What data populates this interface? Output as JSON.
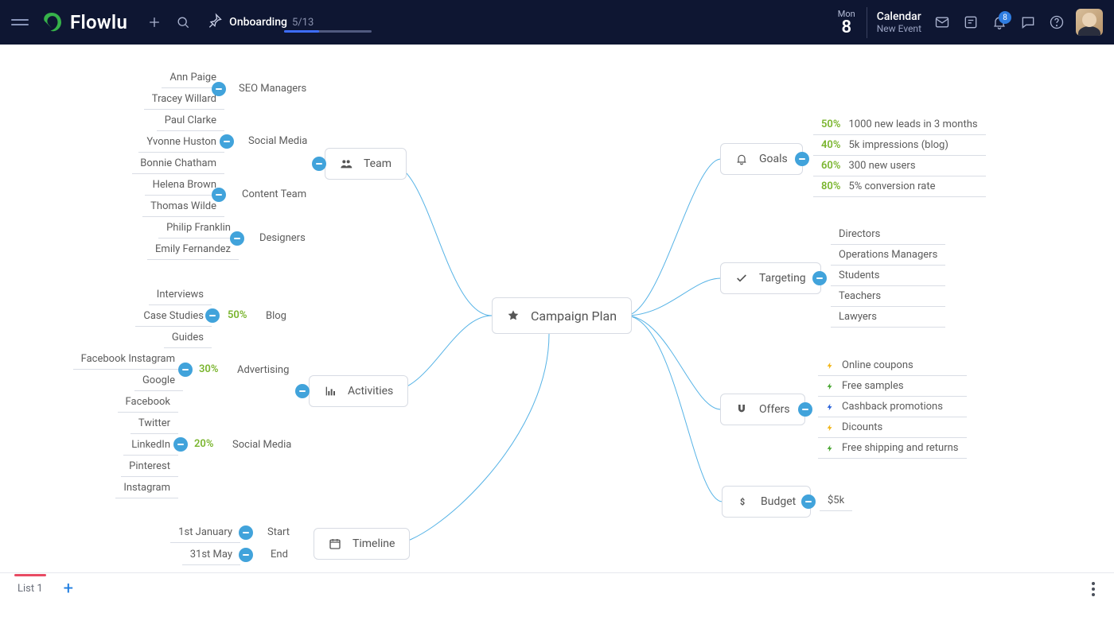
{
  "header": {
    "logo": "Flowlu",
    "onboarding": {
      "label": "Onboarding",
      "count": "5/13"
    },
    "calendar": {
      "dow": "Mon",
      "day": "8",
      "label": "Calendar",
      "new": "New Event"
    },
    "notif_count": "8"
  },
  "center": {
    "title": "Campaign Plan"
  },
  "team": {
    "title": "Team",
    "groups": [
      {
        "label": "SEO Managers",
        "members": [
          "Ann Paige",
          "Tracey  Willard"
        ]
      },
      {
        "label": "Social Media",
        "members": [
          "Paul Clarke",
          "Yvonne Huston",
          "Bonnie Chatham"
        ]
      },
      {
        "label": "Content Team",
        "members": [
          "Helena Brown",
          "Thomas Wilde"
        ]
      },
      {
        "label": "Designers",
        "members": [
          "Philip Franklin",
          "Emily Fernandez"
        ]
      }
    ]
  },
  "activities": {
    "title": "Activities",
    "groups": [
      {
        "pct": "50%",
        "label": "Blog",
        "members": [
          "Interviews",
          "Case Studies",
          "Guides"
        ]
      },
      {
        "pct": "30%",
        "label": "Advertising",
        "members": [
          "Facebook   Instagram",
          "Google"
        ]
      },
      {
        "pct": "20%",
        "label": "Social Media",
        "members": [
          "Facebook",
          "Twitter",
          "LinkedIn",
          "Pinterest",
          "Instagram"
        ]
      }
    ]
  },
  "timeline": {
    "title": "Timeline",
    "rows": [
      {
        "label": "Start",
        "date": "1st January"
      },
      {
        "label": "End",
        "date": "31st May"
      }
    ]
  },
  "goals": {
    "title": "Goals",
    "rows": [
      {
        "pct": "50%",
        "text": "1000 new leads in 3 months"
      },
      {
        "pct": "40%",
        "text": "5k impressions (blog)"
      },
      {
        "pct": "60%",
        "text": "300 new users"
      },
      {
        "pct": "80%",
        "text": "5% conversion rate"
      }
    ]
  },
  "targeting": {
    "title": "Targeting",
    "rows": [
      "Directors",
      "Operations Managers",
      "Students",
      "Teachers",
      "Lawyers"
    ]
  },
  "offers": {
    "title": "Offers",
    "rows": [
      {
        "c": "y",
        "text": "Online coupons"
      },
      {
        "c": "g",
        "text": "Free samples"
      },
      {
        "c": "b",
        "text": "Cashback promotions"
      },
      {
        "c": "y",
        "text": "Dicounts"
      },
      {
        "c": "g",
        "text": "Free shipping and returns"
      }
    ]
  },
  "budget": {
    "title": "Budget",
    "value": "$5k"
  },
  "footer": {
    "tab": "List 1"
  }
}
